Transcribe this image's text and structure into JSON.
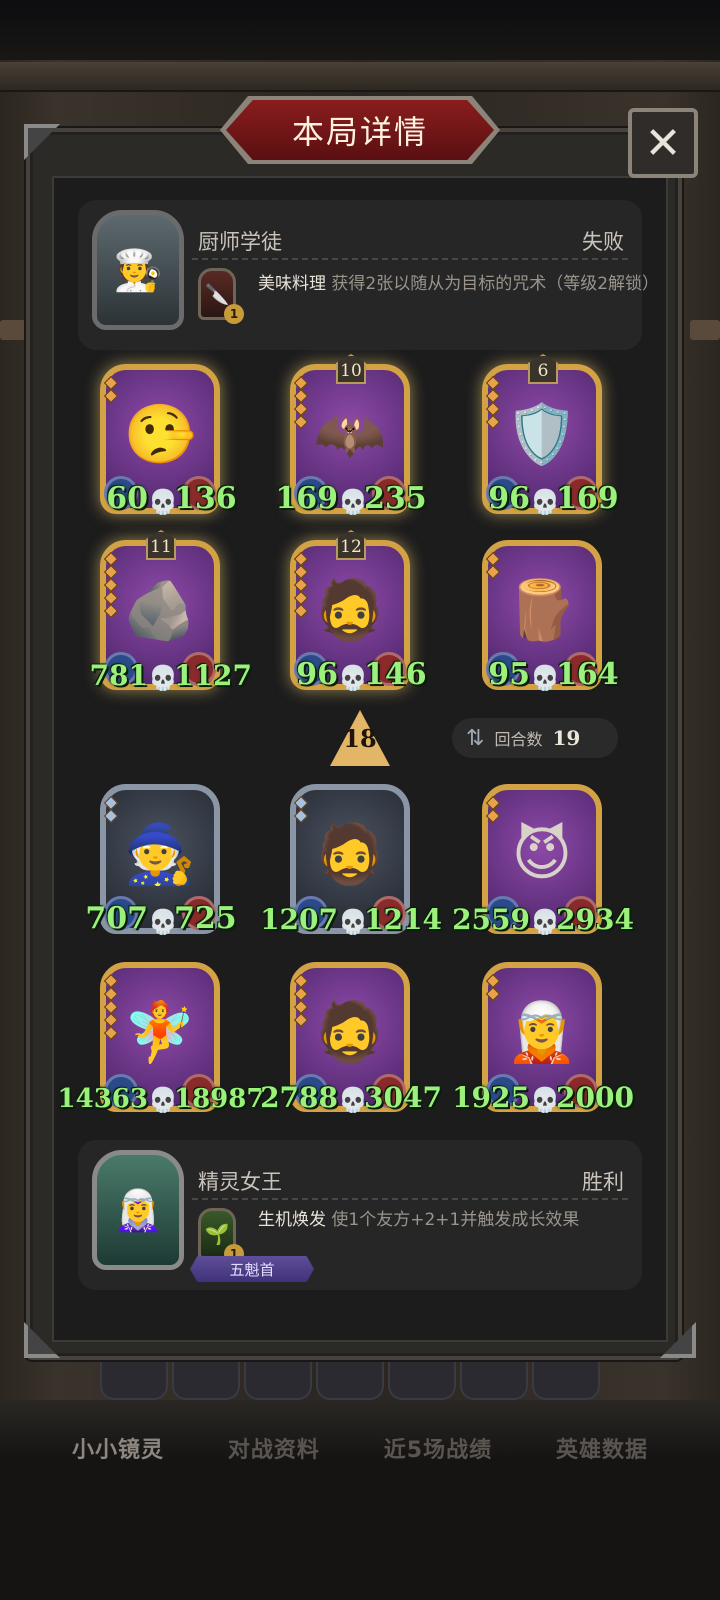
{
  "header": {
    "title": "本局详情",
    "close_symbol": "✕"
  },
  "top_hero": {
    "name": "厨师学徒",
    "result": "失败",
    "power_name": "美味料理",
    "power_desc": "获得2张以随从为目标的咒术（等级2解锁）",
    "power_level": "1",
    "icon": "chef-hero-portrait"
  },
  "top_board": [
    {
      "attack": "60",
      "health": "136",
      "level": "",
      "tier": 2,
      "frame": "gold",
      "art": "🤥"
    },
    {
      "attack": "169",
      "health": "235",
      "level": "10",
      "tier": 4,
      "frame": "gold",
      "art": "🦇"
    },
    {
      "attack": "96",
      "health": "169",
      "level": "6",
      "tier": 4,
      "frame": "gold",
      "art": "🛡️"
    },
    {
      "attack": "781",
      "health": "1127",
      "level": "11",
      "tier": 5,
      "frame": "gold",
      "art": "🪨"
    },
    {
      "attack": "96",
      "health": "146",
      "level": "12",
      "tier": 5,
      "frame": "gold",
      "art": "🧔"
    },
    {
      "attack": "95",
      "health": "164",
      "level": "",
      "tier": 2,
      "frame": "gold-plain",
      "art": "🪵"
    }
  ],
  "middle": {
    "tier_up": "18",
    "rounds_label": "回合数",
    "rounds_value": "19"
  },
  "bottom_board": [
    {
      "attack": "707",
      "health": "725",
      "level": "",
      "tier": 2,
      "frame": "silver",
      "art": "🧙"
    },
    {
      "attack": "1207",
      "health": "1214",
      "level": "",
      "tier": 2,
      "frame": "silver",
      "art": "🧔"
    },
    {
      "attack": "2559",
      "health": "2934",
      "level": "",
      "tier": 2,
      "frame": "gold-plain",
      "art": "😈"
    },
    {
      "attack": "14363",
      "health": "18987",
      "level": "",
      "tier": 5,
      "frame": "gold-plain",
      "art": "🧚"
    },
    {
      "attack": "2788",
      "health": "3047",
      "level": "",
      "tier": 4,
      "frame": "gold-plain",
      "art": "🧔"
    },
    {
      "attack": "1925",
      "health": "2000",
      "level": "",
      "tier": 2,
      "frame": "gold-plain",
      "art": "🧝"
    }
  ],
  "bottom_hero": {
    "name": "精灵女王",
    "result": "胜利",
    "power_name": "生机焕发",
    "power_desc": "使1个友方+2+1并触发成长效果",
    "power_level": "1",
    "badge": "五魁首",
    "icon": "elf-queen-portrait"
  },
  "tabs": [
    "小小镜灵",
    "对战资料",
    "近5场战绩",
    "英雄数据"
  ],
  "colors": {
    "stat_green": "#9cf17c",
    "title_red": "#8a1d1d",
    "gold_frame": "#d3a244"
  }
}
